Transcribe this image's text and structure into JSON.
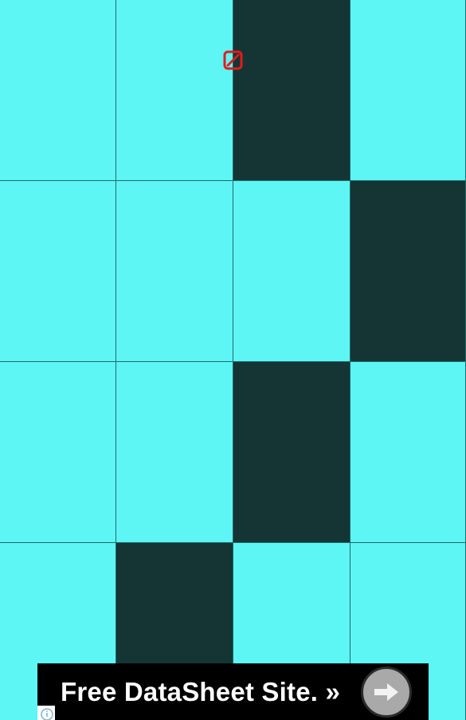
{
  "game": {
    "grid": {
      "columns": 4,
      "rows": 4,
      "dark_tiles": [
        {
          "row": 0,
          "col": 2
        },
        {
          "row": 1,
          "col": 3
        },
        {
          "row": 2,
          "col": 2
        },
        {
          "row": 3,
          "col": 1
        }
      ]
    },
    "colors": {
      "light_tile": "#5ef5f5",
      "dark_tile": "#153535",
      "grid_line": "#1f6a6a",
      "marker": "#e41b1b"
    },
    "marker_icon": "no-entry-square-icon"
  },
  "ad": {
    "text": "Free DataSheet Site. »",
    "arrow_icon": "right-arrow-icon",
    "info_icon": "info-icon"
  }
}
